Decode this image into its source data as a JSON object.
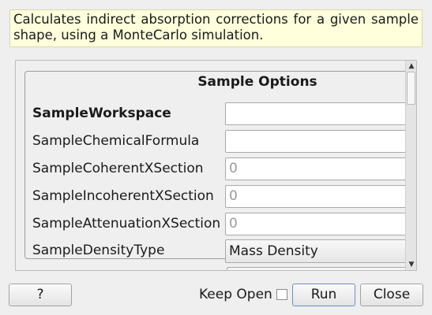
{
  "description": "Calculates indirect absorption corrections for a given sample shape, using a MonteCarlo simulation.",
  "group": {
    "title": "Sample Options",
    "rows": [
      {
        "label": "SampleWorkspace",
        "value": "",
        "placeholder": ""
      },
      {
        "label": "SampleChemicalFormula",
        "value": "",
        "placeholder": ""
      },
      {
        "label": "SampleCoherentXSection",
        "value": "",
        "placeholder": "0"
      },
      {
        "label": "SampleIncoherentXSection",
        "value": "",
        "placeholder": "0"
      },
      {
        "label": "SampleAttenuationXSection",
        "value": "",
        "placeholder": "0"
      },
      {
        "label": "SampleDensityType",
        "value": "Mass Density"
      }
    ]
  },
  "footer": {
    "help_label": "?",
    "keep_open_label": "Keep Open",
    "keep_open_checked": false,
    "run_label": "Run",
    "close_label": "Close"
  }
}
